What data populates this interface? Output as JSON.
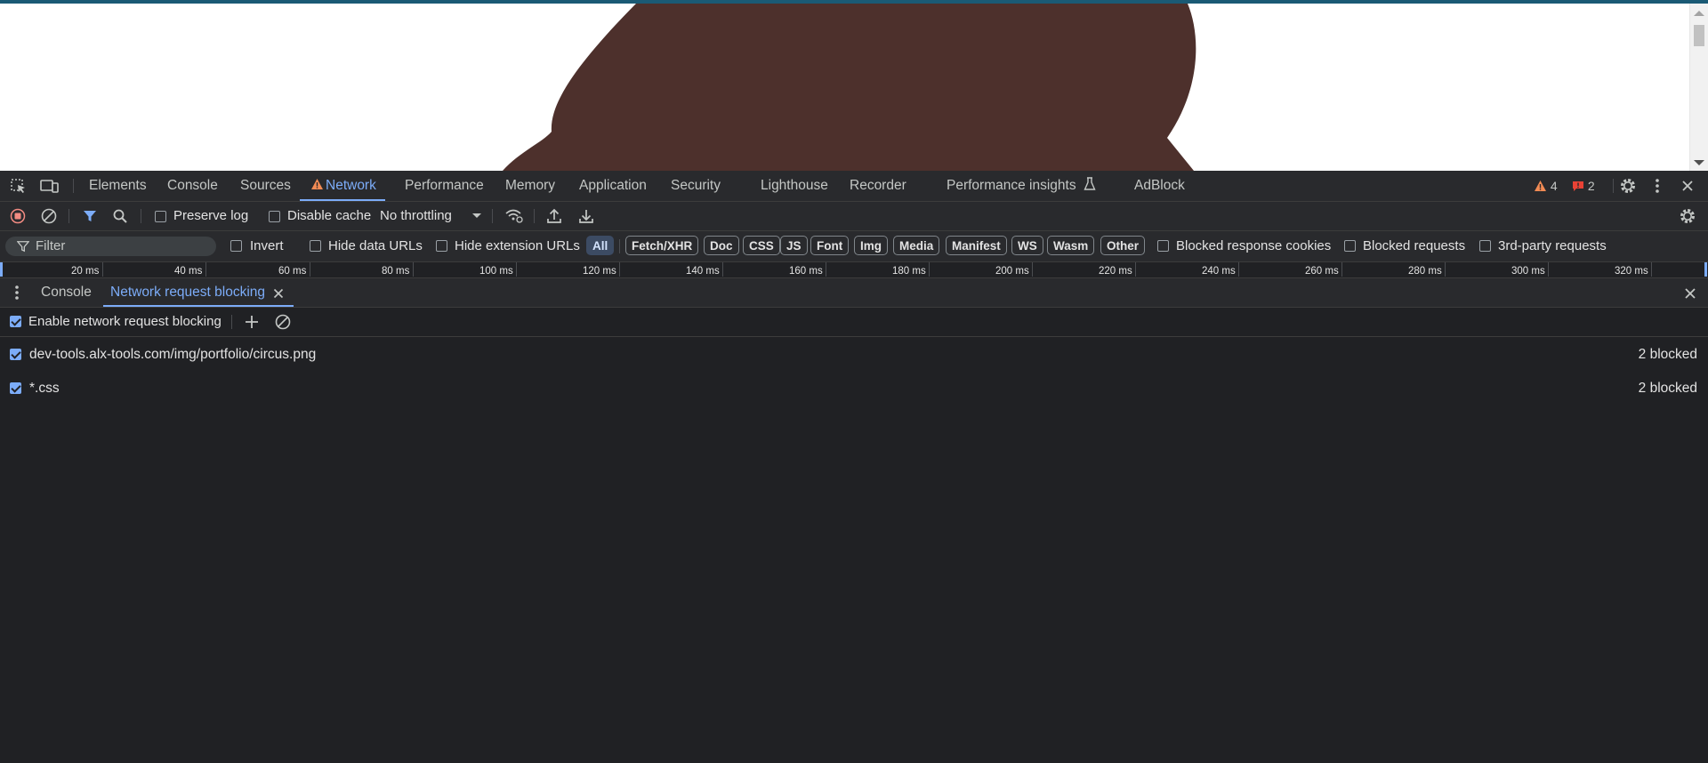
{
  "panel_tabs": [
    {
      "label": "Elements",
      "active": false
    },
    {
      "label": "Console",
      "active": false
    },
    {
      "label": "Sources",
      "active": false
    },
    {
      "label": "Network",
      "active": true,
      "warning_icon": "warning-triangle-icon"
    },
    {
      "label": "Performance",
      "active": false
    },
    {
      "label": "Memory",
      "active": false
    },
    {
      "label": "Application",
      "active": false
    },
    {
      "label": "Security",
      "active": false
    },
    {
      "label": "Lighthouse",
      "active": false
    },
    {
      "label": "Recorder",
      "active": false
    },
    {
      "label": "Performance insights",
      "active": false,
      "icon": "flask-icon"
    },
    {
      "label": "AdBlock",
      "active": false
    }
  ],
  "status": {
    "warnings": "4",
    "errors": "2"
  },
  "toolbar": {
    "preserve_log": {
      "label": "Preserve log",
      "checked": false
    },
    "disable_cache": {
      "label": "Disable cache",
      "checked": false
    },
    "throttling": "No throttling"
  },
  "filter": {
    "placeholder": "Filter",
    "invert": {
      "label": "Invert",
      "checked": false
    },
    "hide_data_urls": {
      "label": "Hide data URLs",
      "checked": false
    },
    "hide_extension_urls": {
      "label": "Hide extension URLs",
      "checked": false
    },
    "types": [
      {
        "label": "All",
        "active": true
      },
      {
        "label": "Fetch/XHR",
        "active": false
      },
      {
        "label": "Doc",
        "active": false
      },
      {
        "label": "CSS",
        "active": false
      },
      {
        "label": "JS",
        "active": false
      },
      {
        "label": "Font",
        "active": false
      },
      {
        "label": "Img",
        "active": false
      },
      {
        "label": "Media",
        "active": false
      },
      {
        "label": "Manifest",
        "active": false
      },
      {
        "label": "WS",
        "active": false
      },
      {
        "label": "Wasm",
        "active": false
      },
      {
        "label": "Other",
        "active": false
      }
    ],
    "blocked_response_cookies": {
      "label": "Blocked response cookies",
      "checked": false
    },
    "blocked_requests": {
      "label": "Blocked requests",
      "checked": false
    },
    "third_party": {
      "label": "3rd-party requests",
      "checked": false
    }
  },
  "timeline": {
    "ticks": [
      "20 ms",
      "40 ms",
      "60 ms",
      "80 ms",
      "100 ms",
      "120 ms",
      "140 ms",
      "160 ms",
      "180 ms",
      "200 ms",
      "220 ms",
      "240 ms",
      "260 ms",
      "280 ms",
      "300 ms",
      "320 ms"
    ]
  },
  "drawer": {
    "tabs": [
      {
        "label": "Console",
        "active": false
      },
      {
        "label": "Network request blocking",
        "active": true,
        "closable": true
      }
    ]
  },
  "blocking": {
    "enable_label": "Enable network request blocking",
    "enabled": true,
    "rules": [
      {
        "pattern": "dev-tools.alx-tools.com/img/portfolio/circus.png",
        "enabled": true,
        "count": "2 blocked"
      },
      {
        "pattern": "*.css",
        "enabled": true,
        "count": "2 blocked"
      }
    ]
  },
  "colors": {
    "devtools_bg": "#202124",
    "toolbar_bg": "#292a2d",
    "accent": "#7cacf8",
    "page_shape": "#4d302c",
    "warning": "#f28b54",
    "error": "#f28b82"
  }
}
